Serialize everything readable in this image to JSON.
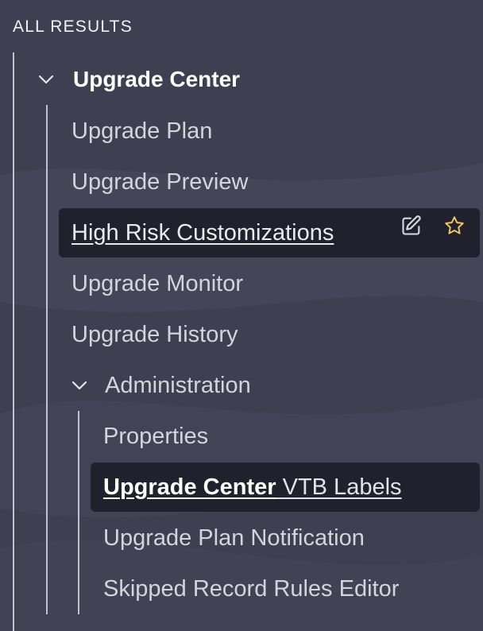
{
  "section": {
    "title": "ALL RESULTS"
  },
  "groups": [
    {
      "title": "Upgrade Center",
      "expanded": true,
      "items": [
        {
          "label": "Upgrade Plan"
        },
        {
          "label": "Upgrade Preview"
        },
        {
          "label": "High Risk Customizations",
          "selected": true,
          "actions": [
            {
              "icon": "edit-icon"
            },
            {
              "icon": "star-outline-icon"
            }
          ]
        },
        {
          "label": "Upgrade Monitor"
        },
        {
          "label": "Upgrade History"
        }
      ],
      "subgroups": [
        {
          "title": "Administration",
          "expanded": true,
          "items": [
            {
              "label": "Properties"
            },
            {
              "label_bold": "Upgrade Center",
              "label_rest": " VTB Labels",
              "selected": true
            },
            {
              "label": "Upgrade Plan Notification"
            },
            {
              "label": "Skipped Record Rules Editor"
            }
          ]
        }
      ]
    }
  ],
  "colors": {
    "background": "#3f3f52",
    "selected_row": "#20212c",
    "star": "#f2c35a",
    "text": "#d3d4dc",
    "heading": "#ffffff"
  }
}
